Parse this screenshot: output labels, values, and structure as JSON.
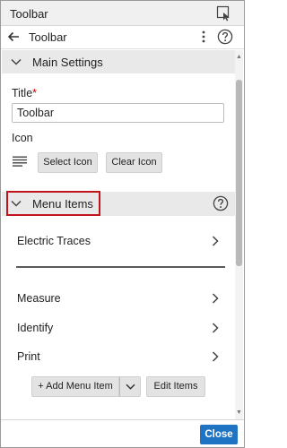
{
  "window": {
    "title": "Toolbar"
  },
  "nav": {
    "title": "Toolbar"
  },
  "main_settings": {
    "header": "Main Settings",
    "title_label": "Title",
    "required_mark": "*",
    "title_value": "Toolbar",
    "icon_label": "Icon",
    "select_icon_label": "Select Icon",
    "clear_icon_label": "Clear Icon"
  },
  "menu_items": {
    "header": "Menu Items",
    "items": [
      {
        "label": "Electric Traces"
      },
      {
        "label": "Measure"
      },
      {
        "label": "Identify"
      },
      {
        "label": "Print"
      }
    ],
    "add_label": "+ Add Menu Item",
    "edit_label": "Edit Items"
  },
  "footer": {
    "close_label": "Close"
  },
  "colors": {
    "accent": "#1e74c2",
    "highlight": "#c0141c",
    "section_bg": "#e9e9e9"
  }
}
